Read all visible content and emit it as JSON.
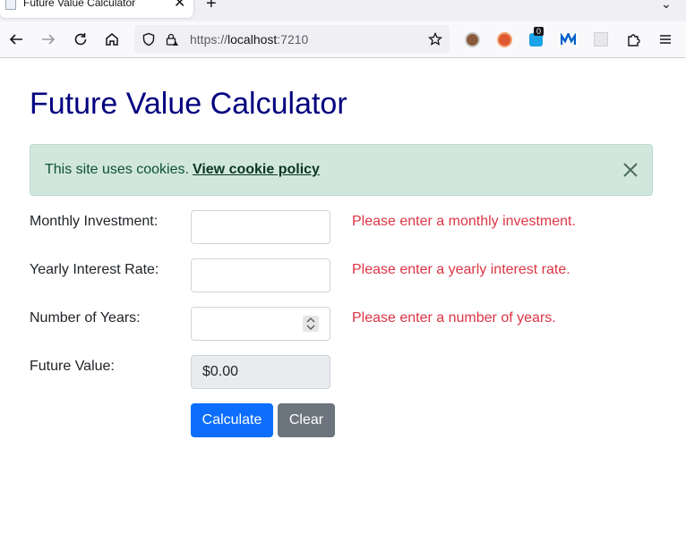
{
  "browser": {
    "tab_title": "Future Value Calculator",
    "tab_close": "✕",
    "new_tab": "+",
    "tab_list": "⌄",
    "url_scheme": "https://",
    "url_host": "localhost",
    "url_port": ":7210",
    "extension_badge": "0"
  },
  "page": {
    "title": "Future Value Calculator"
  },
  "alert": {
    "text": "This site uses cookies.",
    "link": "View cookie policy"
  },
  "form": {
    "monthly_investment": {
      "label": "Monthly Investment:",
      "value": "",
      "error": "Please enter a monthly investment."
    },
    "yearly_rate": {
      "label": "Yearly Interest Rate:",
      "value": "",
      "error": "Please enter a yearly interest rate."
    },
    "years": {
      "label": "Number of Years:",
      "value": "",
      "error": "Please enter a number of years."
    },
    "future_value": {
      "label": "Future Value:",
      "value": "$0.00"
    },
    "calculate_label": "Calculate",
    "clear_label": "Clear"
  },
  "colors": {
    "title": "#000080",
    "alert_bg": "#d1e7dd",
    "alert_text": "#0f5132",
    "error": "#dc3545",
    "primary": "#0d6efd",
    "secondary": "#6c757d"
  }
}
